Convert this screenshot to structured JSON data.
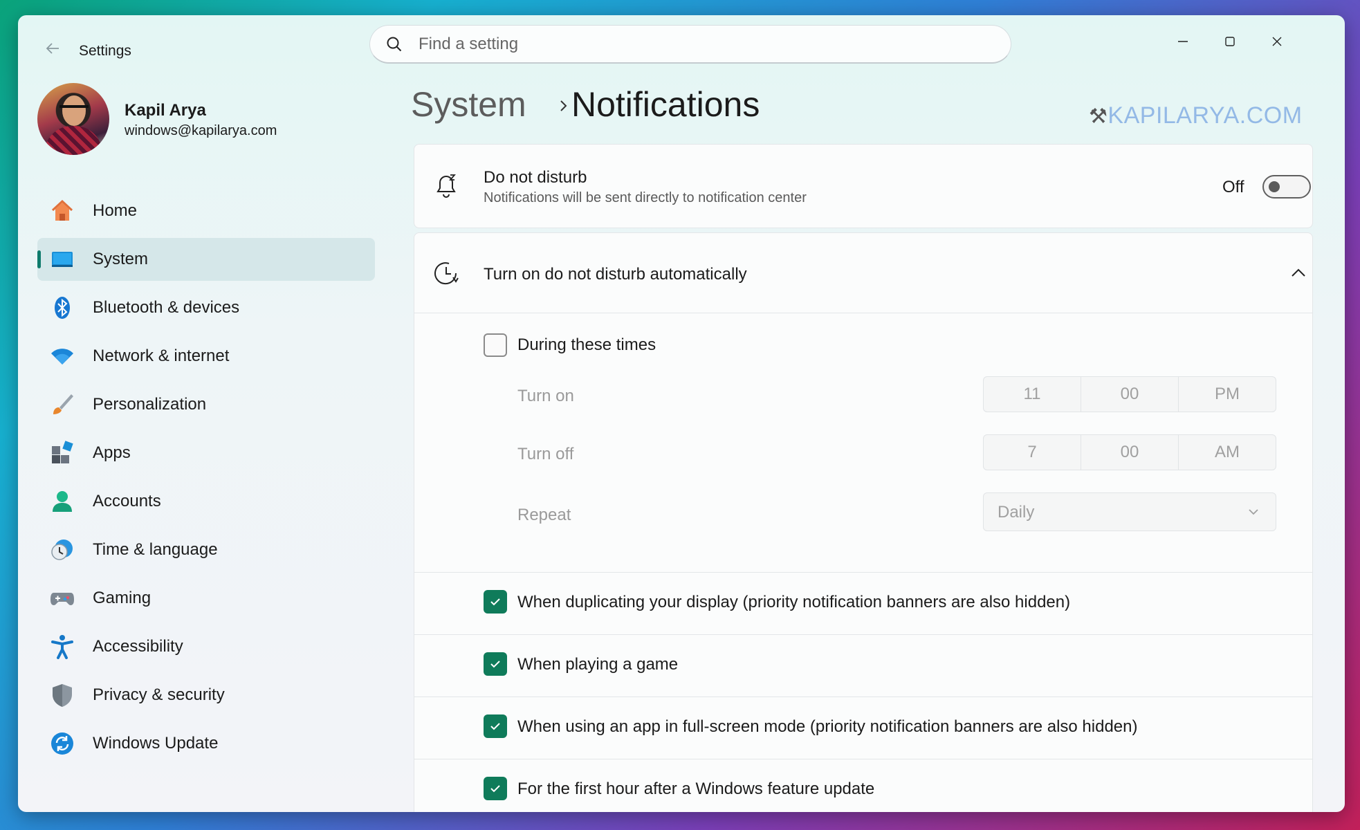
{
  "window": {
    "title": "Settings"
  },
  "search": {
    "placeholder": "Find a setting"
  },
  "profile": {
    "name": "Kapil Arya",
    "email": "windows@kapilarya.com"
  },
  "nav": {
    "items": [
      {
        "label": "Home",
        "icon": "home-icon",
        "active": false
      },
      {
        "label": "System",
        "icon": "system-icon",
        "active": true
      },
      {
        "label": "Bluetooth & devices",
        "icon": "bluetooth-icon",
        "active": false
      },
      {
        "label": "Network & internet",
        "icon": "wifi-icon",
        "active": false
      },
      {
        "label": "Personalization",
        "icon": "brush-icon",
        "active": false
      },
      {
        "label": "Apps",
        "icon": "apps-icon",
        "active": false
      },
      {
        "label": "Accounts",
        "icon": "account-icon",
        "active": false
      },
      {
        "label": "Time & language",
        "icon": "time-language-icon",
        "active": false
      },
      {
        "label": "Gaming",
        "icon": "gamepad-icon",
        "active": false
      },
      {
        "label": "Accessibility",
        "icon": "accessibility-icon",
        "active": false
      },
      {
        "label": "Privacy & security",
        "icon": "shield-icon",
        "active": false
      },
      {
        "label": "Windows Update",
        "icon": "update-icon",
        "active": false
      }
    ]
  },
  "header": {
    "parent": "System",
    "current": "Notifications"
  },
  "watermark": {
    "text": "KAPILARYA.COM"
  },
  "dnd": {
    "title": "Do not disturb",
    "subtitle": "Notifications will be sent directly to notification center",
    "toggle_label": "Off",
    "toggle_on": false
  },
  "auto": {
    "title": "Turn on do not disturb automatically",
    "expanded": true,
    "during_times": {
      "label": "During these times",
      "checked": false,
      "turn_on": {
        "label": "Turn on",
        "hour": "11",
        "minute": "00",
        "period": "PM"
      },
      "turn_off": {
        "label": "Turn off",
        "hour": "7",
        "minute": "00",
        "period": "AM"
      },
      "repeat": {
        "label": "Repeat",
        "value": "Daily"
      }
    },
    "options": [
      {
        "label": "When duplicating your display (priority notification banners are also hidden)",
        "checked": true
      },
      {
        "label": "When playing a game",
        "checked": true
      },
      {
        "label": "When using an app in full-screen mode (priority notification banners are also hidden)",
        "checked": true
      },
      {
        "label": "For the first hour after a Windows feature update",
        "checked": true
      }
    ]
  },
  "colors": {
    "accent": "#0f7b5a",
    "nav_active": "#cde2e4"
  }
}
